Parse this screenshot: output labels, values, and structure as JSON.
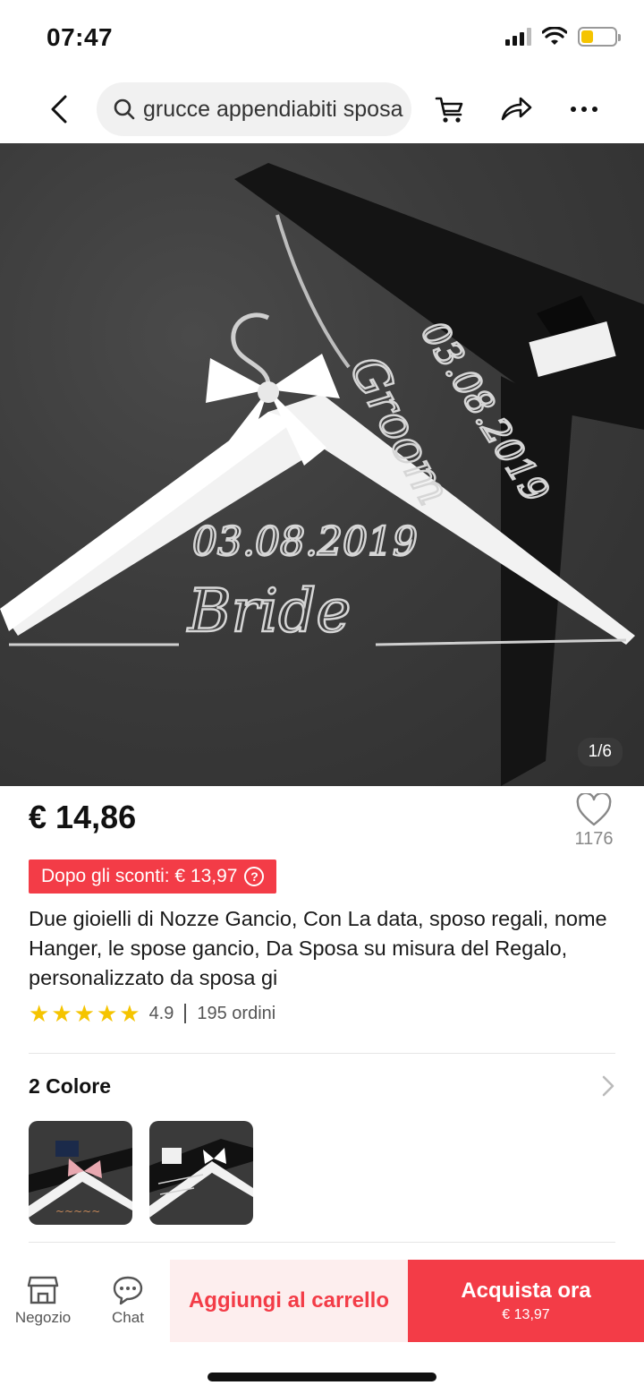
{
  "status_bar": {
    "time": "07:47",
    "battery_level": 0.35
  },
  "nav": {
    "search_text": "grucce appendiabiti sposa",
    "icons": [
      "back-arrow-icon",
      "search-icon",
      "cart-icon",
      "share-icon",
      "more-icon"
    ]
  },
  "gallery": {
    "counter": "1/6",
    "image_lettering": [
      "Groom",
      "03.08.2019",
      "Bride",
      "03.08.2019"
    ]
  },
  "product": {
    "price": "€ 14,86",
    "wishlist_count": "1176",
    "discount_label": "Dopo gli sconti: € 13,97",
    "discount_help": "?",
    "title": "Due gioielli di Nozze Gancio, Con La data, sposo regali, nome Hanger, le spose gancio, Da Sposa su misura del Regalo, personalizzato da sposa gi",
    "rating_value": "4.9",
    "rating_stars": 5,
    "orders": "195 ordini"
  },
  "colors": {
    "label": "2 Colore",
    "swatch_count": 2
  },
  "bottom_bar": {
    "store_label": "Negozio",
    "chat_label": "Chat",
    "add_to_cart": "Aggiungi al carrello",
    "buy_now": "Acquista ora",
    "buy_now_price": "€ 13,97"
  },
  "theme": {
    "accent": "#f33c47",
    "accent_light": "#fdeeee",
    "star": "#f5c400"
  }
}
